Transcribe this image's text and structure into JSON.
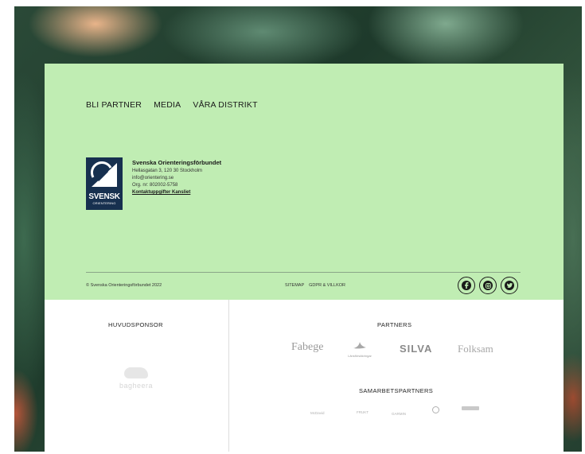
{
  "nav": {
    "items": [
      "BLI PARTNER",
      "MEDIA",
      "VÅRA DISTRIKT"
    ]
  },
  "org": {
    "logo_line1": "SVENSK",
    "logo_line2": "ORIENTERING",
    "name": "Svenska Orienteringsförbundet",
    "address": "Hellasgatan 3, 120 30 Stockholm",
    "email": "info@orientering.se",
    "org_nr": "Org. nr: 802002-5758",
    "contact_link": "Kontaktuppgifter Kansliet"
  },
  "legal": {
    "copyright": "© Svenska Orienteringsförbundet 2022",
    "sitemap": "SITEMAP",
    "gdpr": "GDPR & VILLKOR"
  },
  "social": {
    "icons": [
      "facebook-icon",
      "instagram-icon",
      "twitter-icon"
    ]
  },
  "sponsors": {
    "main_heading": "HUVUDSPONSOR",
    "main_sponsor": "bagheera",
    "partners_heading": "PARTNERS",
    "partners": [
      "Fabege",
      "Länsförsäkringar",
      "SILVA",
      "Folksam"
    ],
    "collab_heading": "SAMARBETSPARTNERS",
    "collab": [
      "McDavid",
      "FRUKT",
      "GARMIN"
    ]
  },
  "colors": {
    "green_panel": "#c0edb3",
    "logo_navy": "#17304f",
    "text_dark": "#1a1a1a"
  }
}
